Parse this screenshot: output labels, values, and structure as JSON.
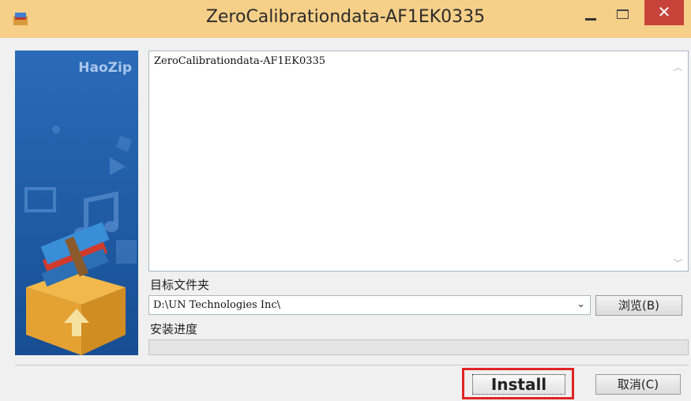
{
  "window": {
    "title": "ZeroCalibrationdata-AF1EK0335",
    "close_glyph": "✕"
  },
  "sidebar": {
    "logo": "HaoZip"
  },
  "content": {
    "text": "ZeroCalibrationdata-AF1EK0335"
  },
  "target": {
    "label": "目标文件夹",
    "path": "D:\\UN Technologies Inc\\",
    "browse_label": "浏览(B)"
  },
  "progress": {
    "label": "安装进度",
    "value": 0
  },
  "footer": {
    "install_label": "Install",
    "cancel_label": "取消(C)"
  },
  "colors": {
    "titlebar": "#f6cf88",
    "close": "#c7433a",
    "sidebar": "#1f5ea8",
    "highlight": "#e02424"
  }
}
